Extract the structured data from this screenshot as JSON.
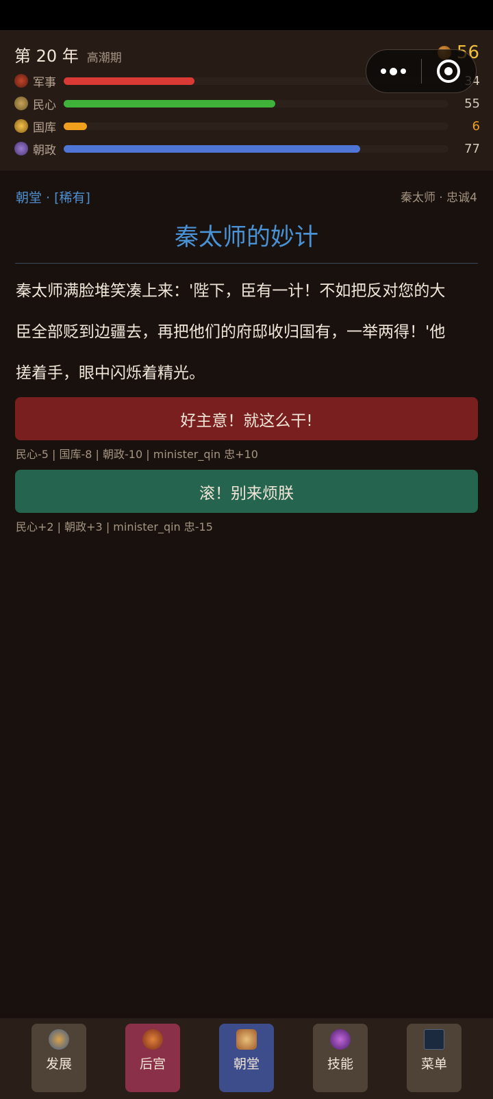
{
  "header": {
    "year": "第 20 年",
    "era": "高潮期",
    "gold": "56",
    "stats": [
      {
        "label": "军事",
        "value": "34",
        "level": 34,
        "color": "#d93a36",
        "icon": "military-icon"
      },
      {
        "label": "民心",
        "value": "55",
        "level": 55,
        "color": "#3fb23a",
        "icon": "people-icon"
      },
      {
        "label": "国库",
        "value": "6",
        "level": 6,
        "color": "#f0a01c",
        "icon": "treasury-icon"
      },
      {
        "label": "朝政",
        "value": "77",
        "level": 77,
        "color": "#4f76d6",
        "icon": "court-icon"
      }
    ]
  },
  "event": {
    "category": "朝堂 · [稀有]",
    "source": "秦太师 · 忠诚4",
    "title": "秦太师的妙计",
    "text": "秦太师满脸堆笑凑上来：'陛下，臣有一计！不如把反对您的大臣全部贬到边疆去，再把他们的府邸收归国有，一举两得！'他搓着手，眼中闪烁着精光。"
  },
  "choices": [
    {
      "label": "好主意！就这么干!",
      "effect": "民心-5 | 国库-8 | 朝政-10 | minister_qin 忠+10",
      "color": "#7a1f1f"
    },
    {
      "label": "滚！别来烦朕",
      "effect": "民心+2 | 朝政+3 | minister_qin 忠-15",
      "color": "#256550"
    }
  ],
  "nav": [
    {
      "label": "发展",
      "color": "#4f4338",
      "icon": "development-icon"
    },
    {
      "label": "后宫",
      "color": "#8a3048",
      "icon": "harem-icon"
    },
    {
      "label": "朝堂",
      "color": "#3d4d8c",
      "icon": "court-hall-icon"
    },
    {
      "label": "技能",
      "color": "#4f4338",
      "icon": "skills-icon"
    },
    {
      "label": "菜单",
      "color": "#4f4338",
      "icon": "menu-icon"
    }
  ]
}
